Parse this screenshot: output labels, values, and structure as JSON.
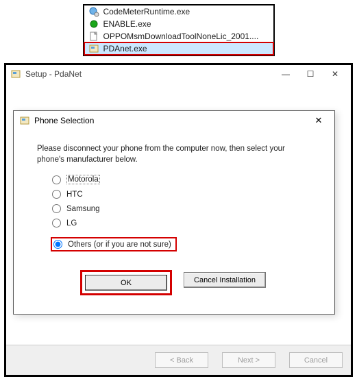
{
  "file_list": {
    "items": [
      {
        "name": "CodeMeterRuntime.exe",
        "icon": "globe-gear-icon"
      },
      {
        "name": "ENABLE.exe",
        "icon": "green-dot-icon"
      },
      {
        "name": "OPPOMsmDownloadToolNoneLic_2001....",
        "icon": "file-icon"
      },
      {
        "name": "PDAnet.exe",
        "icon": "installer-icon"
      }
    ],
    "selected_index": 3
  },
  "setup_window": {
    "title": "Setup - PdaNet",
    "buttons": {
      "back": "< Back",
      "next": "Next >",
      "cancel": "Cancel"
    }
  },
  "dialog": {
    "title": "Phone Selection",
    "instruction": "Please disconnect your phone from the computer now, then select your phone's manufacturer below.",
    "options": [
      "Motorola",
      "HTC",
      "Samsung",
      "LG",
      "Others (or if you are not sure)"
    ],
    "selected_option_index": 4,
    "buttons": {
      "ok": "OK",
      "cancel": "Cancel Installation"
    }
  }
}
